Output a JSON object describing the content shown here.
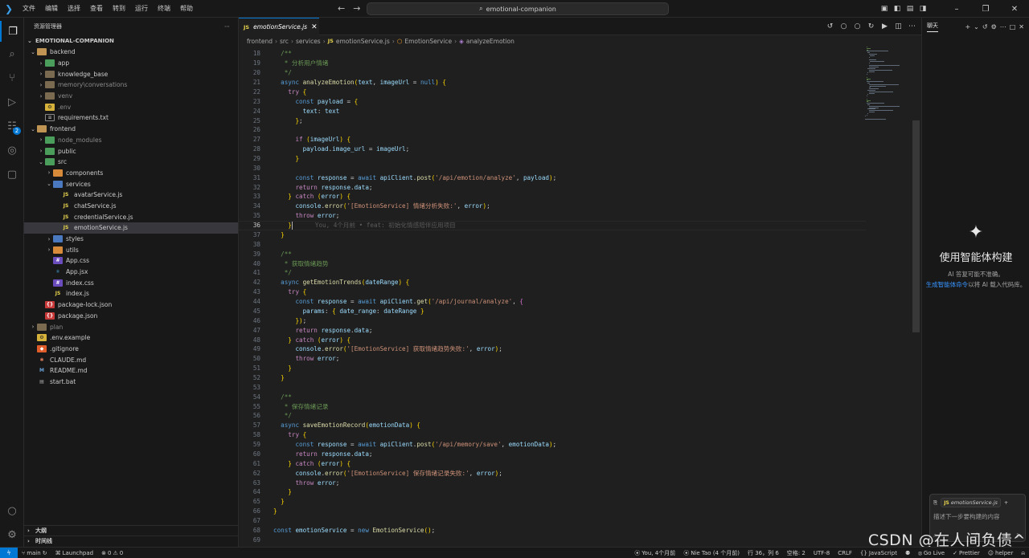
{
  "titlebar": {
    "menu": [
      "文件",
      "编辑",
      "选择",
      "查看",
      "转到",
      "运行",
      "终端",
      "帮助"
    ],
    "search_text": "emotional-companion"
  },
  "explorer": {
    "title": "资源管理器",
    "root": "EMOTIONAL-COMPANION",
    "items": [
      {
        "label": "backend",
        "depth": 0,
        "kind": "folder",
        "open": true
      },
      {
        "label": "app",
        "depth": 1,
        "kind": "folder",
        "color": "green"
      },
      {
        "label": "knowledge_base",
        "depth": 1,
        "kind": "folder",
        "color": "gray"
      },
      {
        "label": "memory\\conversations",
        "depth": 1,
        "kind": "folder",
        "color": "gray",
        "dim": true
      },
      {
        "label": "venv",
        "depth": 1,
        "kind": "folder",
        "color": "gray",
        "dim": true
      },
      {
        "label": ".env",
        "depth": 1,
        "kind": "env",
        "dim": true
      },
      {
        "label": "requirements.txt",
        "depth": 1,
        "kind": "txt"
      },
      {
        "label": "frontend",
        "depth": 0,
        "kind": "folder",
        "open": true
      },
      {
        "label": "node_modules",
        "depth": 1,
        "kind": "folder",
        "color": "green",
        "dim": true
      },
      {
        "label": "public",
        "depth": 1,
        "kind": "folder",
        "color": "green"
      },
      {
        "label": "src",
        "depth": 1,
        "kind": "folder",
        "color": "green",
        "open": true
      },
      {
        "label": "components",
        "depth": 2,
        "kind": "folder",
        "color": "orange"
      },
      {
        "label": "services",
        "depth": 2,
        "kind": "folder",
        "color": "blue",
        "open": true
      },
      {
        "label": "avatarService.js",
        "depth": 3,
        "kind": "js"
      },
      {
        "label": "chatService.js",
        "depth": 3,
        "kind": "js"
      },
      {
        "label": "credentialService.js",
        "depth": 3,
        "kind": "js"
      },
      {
        "label": "emotionService.js",
        "depth": 3,
        "kind": "js",
        "selected": true
      },
      {
        "label": "styles",
        "depth": 2,
        "kind": "folder",
        "color": "blue"
      },
      {
        "label": "utils",
        "depth": 2,
        "kind": "folder",
        "color": "orange"
      },
      {
        "label": "App.css",
        "depth": 2,
        "kind": "css"
      },
      {
        "label": "App.jsx",
        "depth": 2,
        "kind": "jsx"
      },
      {
        "label": "index.css",
        "depth": 2,
        "kind": "css"
      },
      {
        "label": "index.js",
        "depth": 2,
        "kind": "js"
      },
      {
        "label": "package-lock.json",
        "depth": 1,
        "kind": "json"
      },
      {
        "label": "package.json",
        "depth": 1,
        "kind": "json"
      },
      {
        "label": "plan",
        "depth": 0,
        "kind": "folder",
        "color": "gray",
        "dim": true
      },
      {
        "label": ".env.example",
        "depth": 0,
        "kind": "env"
      },
      {
        "label": ".gitignore",
        "depth": 0,
        "kind": "git"
      },
      {
        "label": "CLAUDE.md",
        "depth": 0,
        "kind": "claude"
      },
      {
        "label": "README.md",
        "depth": 0,
        "kind": "md"
      },
      {
        "label": "start.bat",
        "depth": 0,
        "kind": "bat"
      }
    ],
    "outline_label": "大纲",
    "timeline_label": "时间线"
  },
  "editor": {
    "tab_label": "emotionService.js",
    "breadcrumb": [
      "frontend",
      "src",
      "services",
      "emotionService.js",
      "EmotionService",
      "analyzeEmotion"
    ],
    "first_line": 18,
    "current_line": 36,
    "lines": [
      "  /**",
      "   * 分析用户情绪",
      "   */",
      "  async analyzeEmotion(text, imageUrl = null) {",
      "    try {",
      "      const payload = {",
      "        text: text",
      "      };",
      "",
      "      if (imageUrl) {",
      "        payload.image_url = imageUrl;",
      "      }",
      "",
      "      const response = await apiClient.post('/api/emotion/analyze', payload);",
      "      return response.data;",
      "    } catch (error) {",
      "      console.error('[EmotionService] 情绪分析失败:', error);",
      "      throw error;",
      "    }",
      "  }",
      "",
      "  /**",
      "   * 获取情绪趋势",
      "   */",
      "  async getEmotionTrends(dateRange) {",
      "    try {",
      "      const response = await apiClient.get('/api/journal/analyze', {",
      "        params: { date_range: dateRange }",
      "      });",
      "      return response.data;",
      "    } catch (error) {",
      "      console.error('[EmotionService] 获取情绪趋势失败:', error);",
      "      throw error;",
      "    }",
      "  }",
      "",
      "  /**",
      "   * 保存情绪记录",
      "   */",
      "  async saveEmotionRecord(emotionData) {",
      "    try {",
      "      const response = await apiClient.post('/api/memory/save', emotionData);",
      "      return response.data;",
      "    } catch (error) {",
      "      console.error('[EmotionService] 保存情绪记录失败:', error);",
      "      throw error;",
      "    }",
      "  }",
      "}",
      "",
      "const emotionService = new EmotionService();",
      ""
    ],
    "blame_annotation": "You, 4个月前 • feat: 初始化情感陪伴应用项目"
  },
  "chat": {
    "tab_label": "聊天",
    "heading": "使用智能体构建",
    "warning": "AI 答复可能不准确。",
    "link_text": "生成智能体命令",
    "rest_text": "以将 AI 载入代码库。",
    "context_file": "emotionService.js",
    "input_placeholder": "描述下一步要构建的内容"
  },
  "statusbar": {
    "branch": "main",
    "launchpad": "Launchpad",
    "errors": "0",
    "warnings": "0",
    "blame": "You, 4个月前",
    "author": "Nie Tao (4 个月前)",
    "position": "行 36，列 6",
    "indent": "空格: 2",
    "encoding": "UTF-8",
    "eol": "CRLF",
    "language": "JavaScript",
    "golive": "Go Live",
    "prettier": "Prettier",
    "helper": "helper"
  },
  "watermark": "CSDN @在人间负债^",
  "colors": {
    "accent": "#0078d4",
    "editor_bg": "#1f1f1f",
    "sidebar_bg": "#181818"
  }
}
